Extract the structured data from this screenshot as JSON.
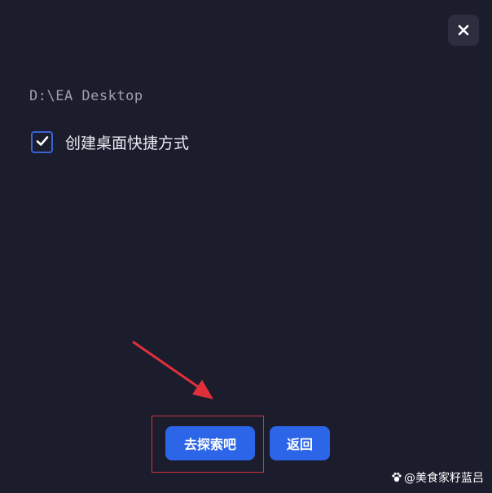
{
  "dialog": {
    "install_path": "D:\\EA Desktop",
    "shortcut_checkbox": {
      "label": "创建桌面快捷方式",
      "checked": true
    },
    "primary_button_label": "去探索吧",
    "secondary_button_label": "返回",
    "close_icon": "close-icon"
  },
  "annotation": {
    "arrow_color": "#e0303a",
    "box_color": "#d2333d"
  },
  "watermark": {
    "text": "@美食家籽蓝吕"
  },
  "colors": {
    "background": "#1b1c2c",
    "accent": "#2c65e8"
  }
}
